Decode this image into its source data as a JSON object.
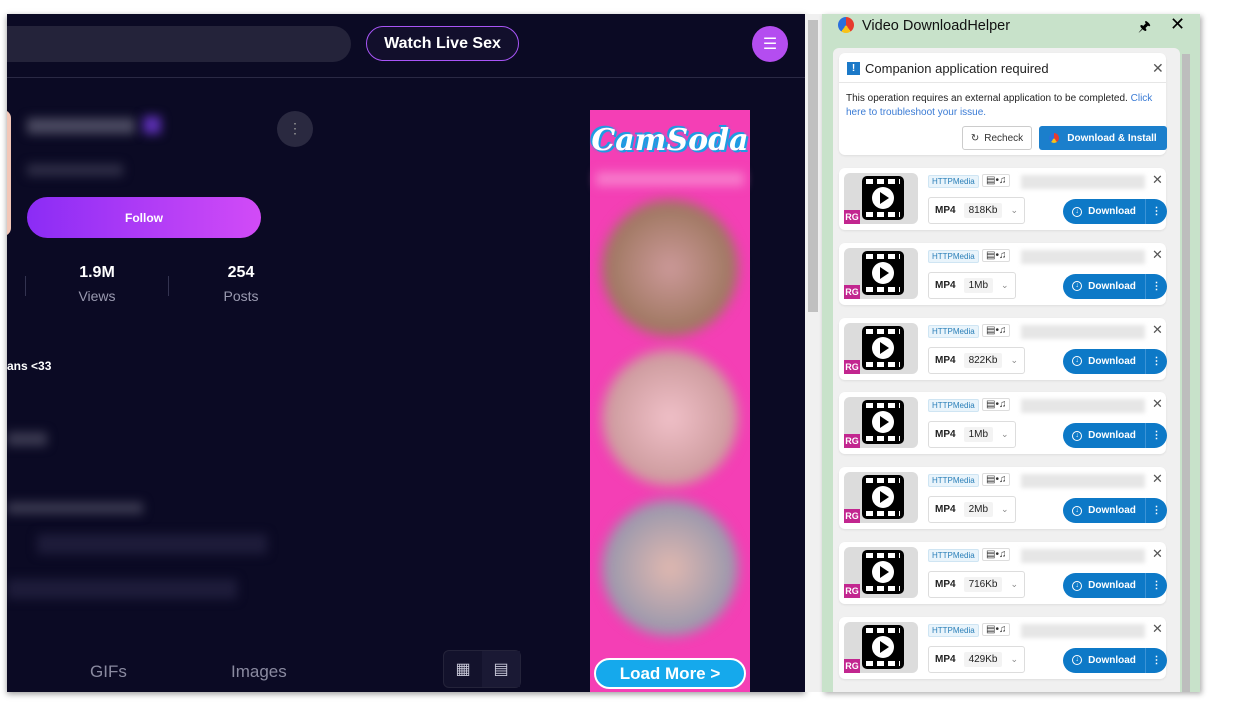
{
  "site": {
    "watch_live_label": "Watch Live Sex",
    "menu_icon": "hamburger-icon",
    "follow_label": "Follow",
    "stats": [
      {
        "value": "1.9M",
        "label": "Views"
      },
      {
        "value": "254",
        "label": "Posts"
      }
    ],
    "bio_fragment": "ans <33",
    "tabs": [
      "GIFs",
      "Images"
    ],
    "ad": {
      "brand": "CamSoda",
      "load_more_label": "Load More >",
      "colors": {
        "background": "#f43fb5",
        "button": "#15a9ec"
      }
    }
  },
  "extension": {
    "title": "Video DownloadHelper",
    "notice": {
      "title": "Companion application required",
      "text": "This operation requires an external application to be completed.",
      "link": "Click here to troubleshoot your issue.",
      "recheck_label": "Recheck",
      "install_label": "Download & Install"
    },
    "items": [
      {
        "source": "HTTPMedia",
        "format": "MP4",
        "size": "818Kb"
      },
      {
        "source": "HTTPMedia",
        "format": "MP4",
        "size": "1Mb"
      },
      {
        "source": "HTTPMedia",
        "format": "MP4",
        "size": "822Kb"
      },
      {
        "source": "HTTPMedia",
        "format": "MP4",
        "size": "1Mb"
      },
      {
        "source": "HTTPMedia",
        "format": "MP4",
        "size": "2Mb"
      },
      {
        "source": "HTTPMedia",
        "format": "MP4",
        "size": "716Kb"
      },
      {
        "source": "HTTPMedia",
        "format": "MP4",
        "size": "429Kb"
      }
    ],
    "download_label": "Download",
    "thumb_badge": "RG",
    "accent": "#0d79c7"
  }
}
